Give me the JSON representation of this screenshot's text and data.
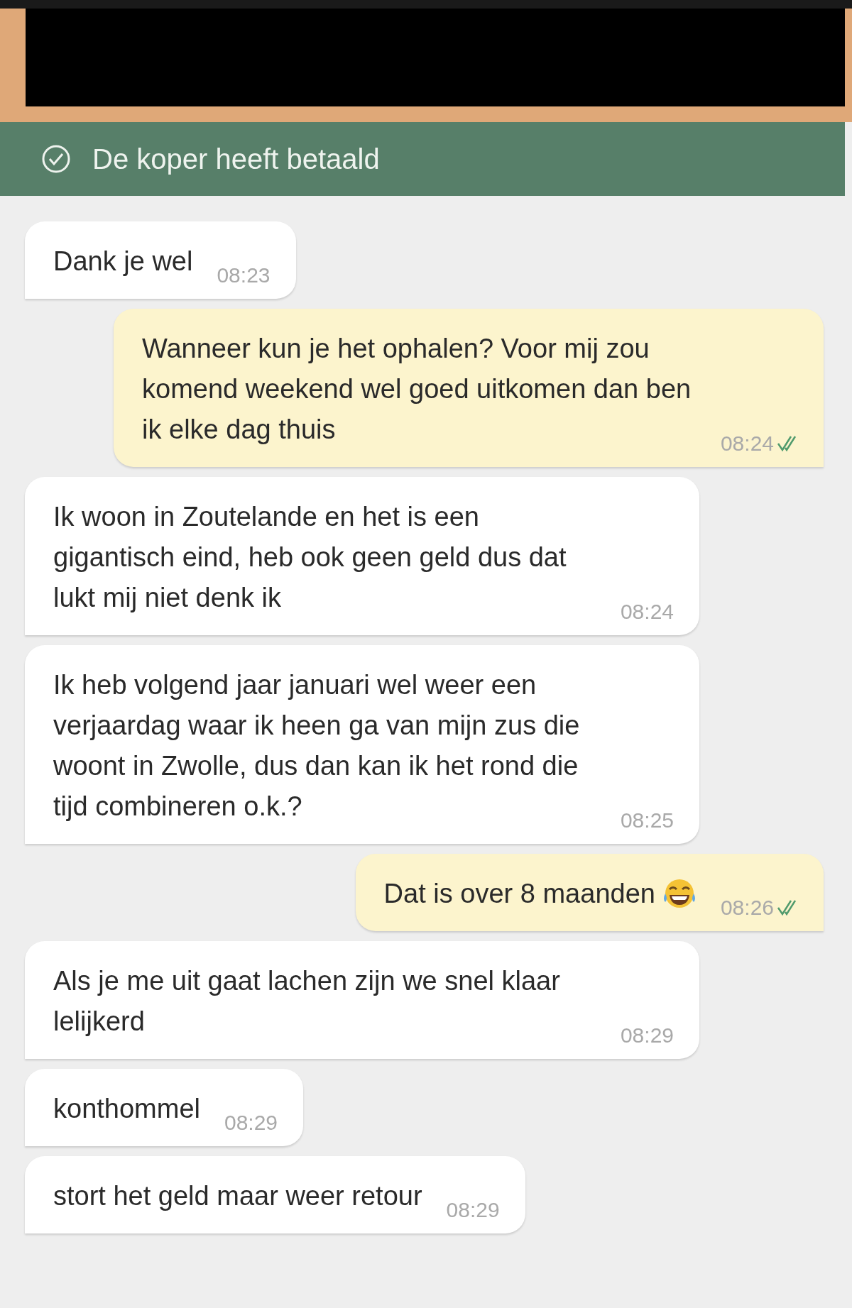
{
  "banner": {
    "text": "De koper heeft betaald"
  },
  "messages": [
    {
      "kind": "incoming",
      "text": "Dank je wel",
      "time": "08:23",
      "emoji": false,
      "read": false
    },
    {
      "kind": "outgoing",
      "text": "Wanneer kun je het ophalen? Voor mij zou komend weekend wel goed uitkomen dan ben ik elke dag thuis",
      "time": "08:24",
      "emoji": false,
      "read": true
    },
    {
      "kind": "incoming",
      "text": "Ik woon in Zoutelande en het is een gigantisch eind, heb ook geen geld dus dat lukt mij niet denk ik",
      "time": "08:24",
      "emoji": false,
      "read": false
    },
    {
      "kind": "incoming",
      "text": "Ik heb volgend jaar januari wel weer een verjaardag waar ik heen ga van mijn zus die woont in Zwolle, dus dan kan ik het rond die tijd combineren o.k.?",
      "time": "08:25",
      "emoji": false,
      "read": false
    },
    {
      "kind": "outgoing",
      "text": "Dat is over 8 maanden",
      "time": "08:26",
      "emoji": true,
      "read": true
    },
    {
      "kind": "incoming",
      "text": "Als je me uit gaat lachen zijn we snel klaar lelijkerd",
      "time": "08:29",
      "emoji": false,
      "read": false
    },
    {
      "kind": "incoming",
      "text": "konthommel",
      "time": "08:29",
      "emoji": false,
      "read": false
    },
    {
      "kind": "incoming",
      "text": "stort het geld maar weer retour",
      "time": "08:29",
      "emoji": false,
      "read": false
    }
  ]
}
